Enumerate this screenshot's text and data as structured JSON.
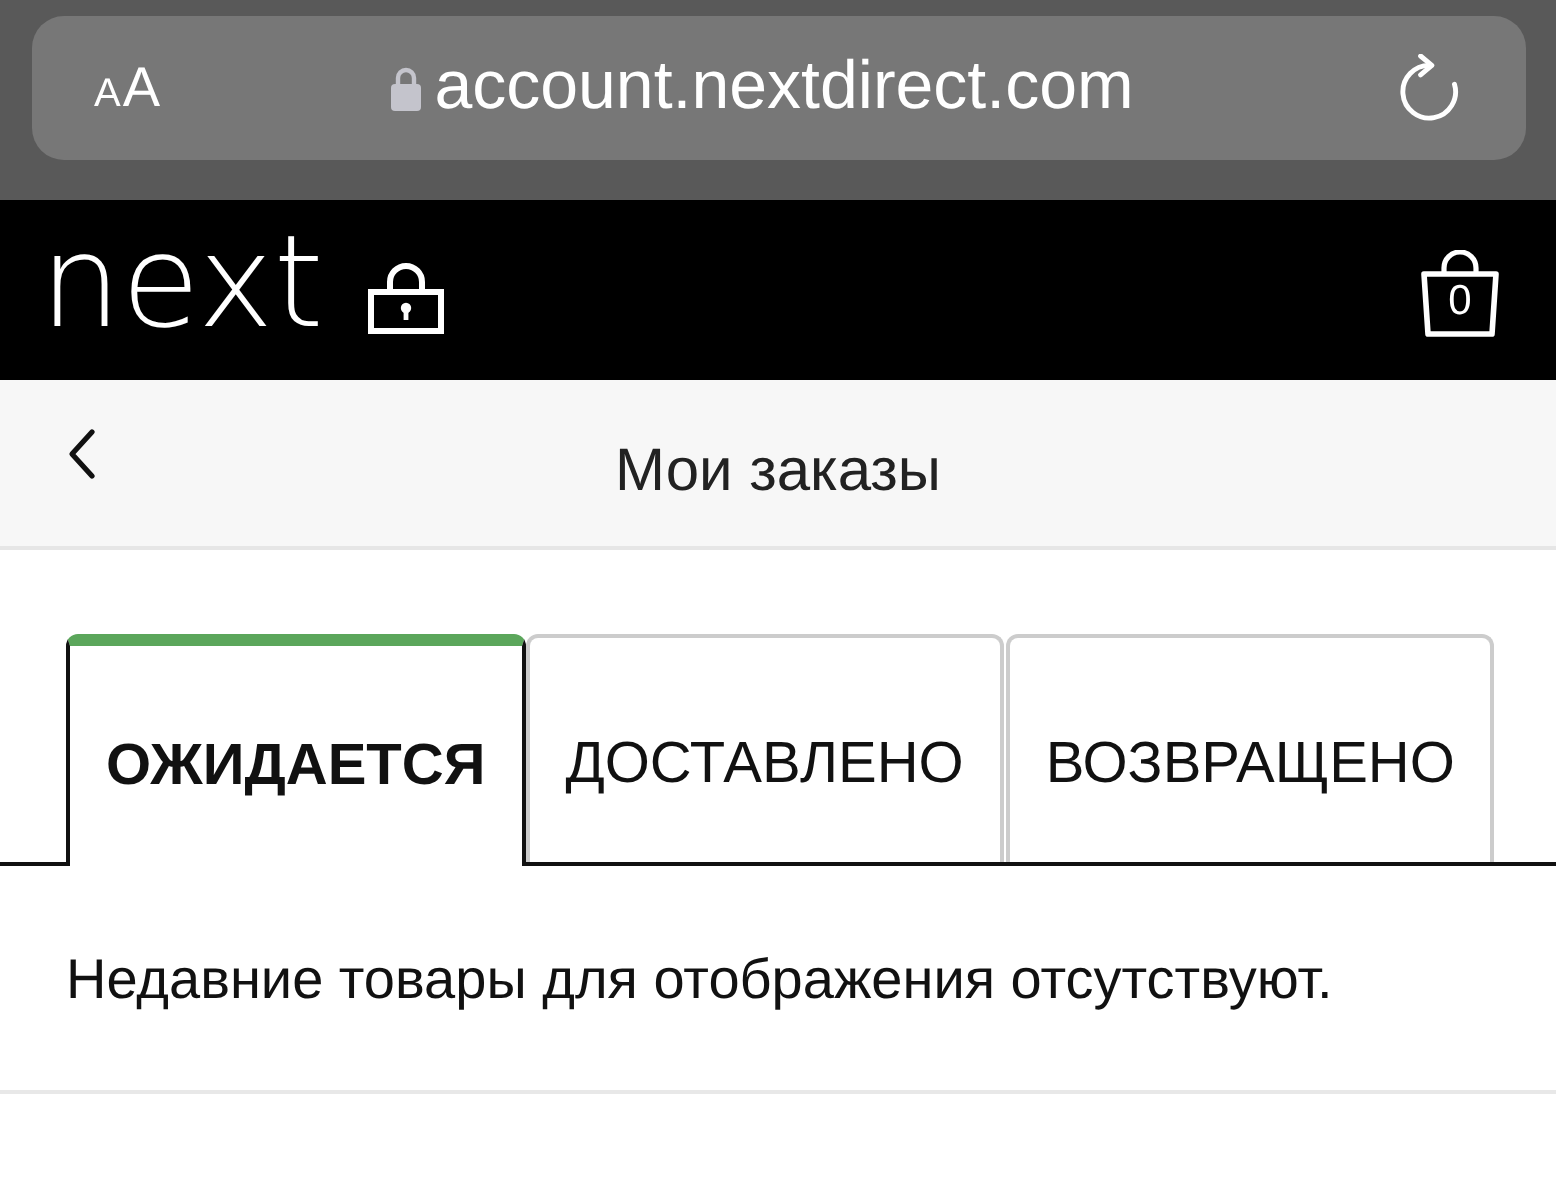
{
  "browser": {
    "text_size_button": "AA",
    "url": "account.nextdirect.com"
  },
  "header": {
    "logo": "next",
    "cart_count": "0"
  },
  "page_title": "Мои заказы",
  "tabs": [
    {
      "label": "ОЖИДАЕТСЯ",
      "selected": true
    },
    {
      "label": "ДОСТАВЛЕНО",
      "selected": false
    },
    {
      "label": "ВОЗВРАЩЕНО",
      "selected": false
    }
  ],
  "empty_message": "Недавние товары для отображения отсутствуют."
}
